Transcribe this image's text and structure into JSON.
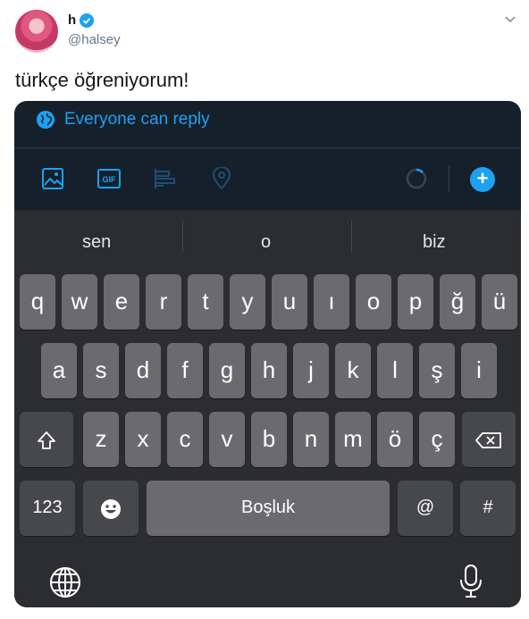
{
  "tweet": {
    "author_name": "h",
    "author_handle": "@halsey",
    "text": "türkçe öğreniyorum!"
  },
  "composer": {
    "reply_setting": "Everyone can reply",
    "toolbar_icons": [
      "image-icon",
      "gif-icon",
      "poll-icon",
      "location-icon",
      "progress-ring-icon",
      "add-icon"
    ],
    "gif_label": "GIF",
    "add_label": "+"
  },
  "keyboard": {
    "suggestions": [
      "sen",
      "o",
      "biz"
    ],
    "row1": [
      "q",
      "w",
      "e",
      "r",
      "t",
      "y",
      "u",
      "ı",
      "o",
      "p",
      "ğ",
      "ü"
    ],
    "row2": [
      "a",
      "s",
      "d",
      "f",
      "g",
      "h",
      "j",
      "k",
      "l",
      "ş",
      "i"
    ],
    "row3": [
      "z",
      "x",
      "c",
      "v",
      "b",
      "n",
      "m",
      "ö",
      "ç"
    ],
    "numbers_label": "123",
    "space_label": "Boşluk",
    "at_label": "@",
    "hash_label": "#"
  },
  "colors": {
    "accent": "#1da1f2",
    "keyboard_bg": "#2b2d31",
    "composer_bg": "#15202b"
  }
}
